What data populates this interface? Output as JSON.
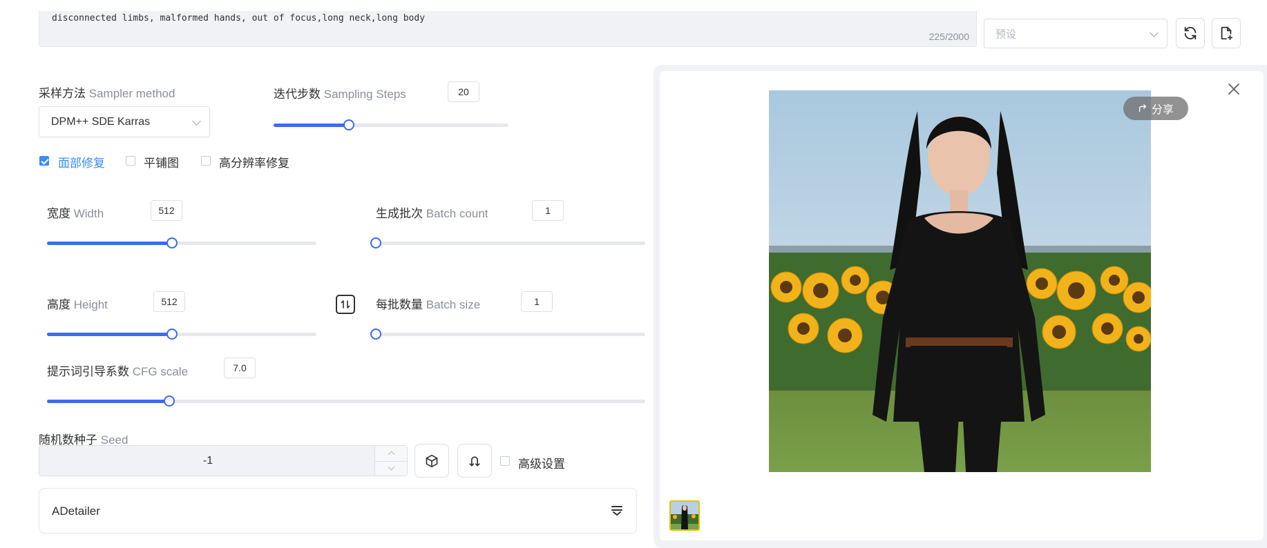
{
  "negative_prompt": {
    "text": "disconnected limbs, malformed hands, out of focus,long neck,long body",
    "counter": "225/2000"
  },
  "preset": {
    "placeholder": "预设"
  },
  "sampler": {
    "label_cn": "采样方法",
    "label_en": "Sampler method",
    "value": "DPM++ SDE Karras"
  },
  "steps": {
    "label_cn": "迭代步数",
    "label_en": "Sampling Steps",
    "value": "20",
    "fraction": 0.32
  },
  "options": {
    "face_restore": {
      "label": "面部修复",
      "checked": true
    },
    "tiling": {
      "label": "平铺图",
      "checked": false
    },
    "hires_fix": {
      "label": "高分辨率修复",
      "checked": false
    }
  },
  "width": {
    "label_cn": "宽度",
    "label_en": "Width",
    "value": "512",
    "fraction": 0.465
  },
  "height": {
    "label_cn": "高度",
    "label_en": "Height",
    "value": "512",
    "fraction": 0.465
  },
  "batch_count": {
    "label_cn": "生成批次",
    "label_en": "Batch count",
    "value": "1",
    "fraction": 0.0
  },
  "batch_size": {
    "label_cn": "每批数量",
    "label_en": "Batch size",
    "value": "1",
    "fraction": 0.0
  },
  "cfg": {
    "label_cn": "提示词引导系数",
    "label_en": "CFG scale",
    "value": "7.0",
    "fraction": 0.204
  },
  "seed": {
    "label_cn": "随机数种子",
    "label_en": "Seed",
    "value": "-1"
  },
  "advanced": {
    "label": "高级设置",
    "checked": false
  },
  "adetailer": {
    "label": "ADetailer"
  },
  "preview": {
    "share_label": "分享"
  },
  "colors": {
    "accent": "#3a6bf0",
    "checkbox": "#3a8ef6"
  }
}
